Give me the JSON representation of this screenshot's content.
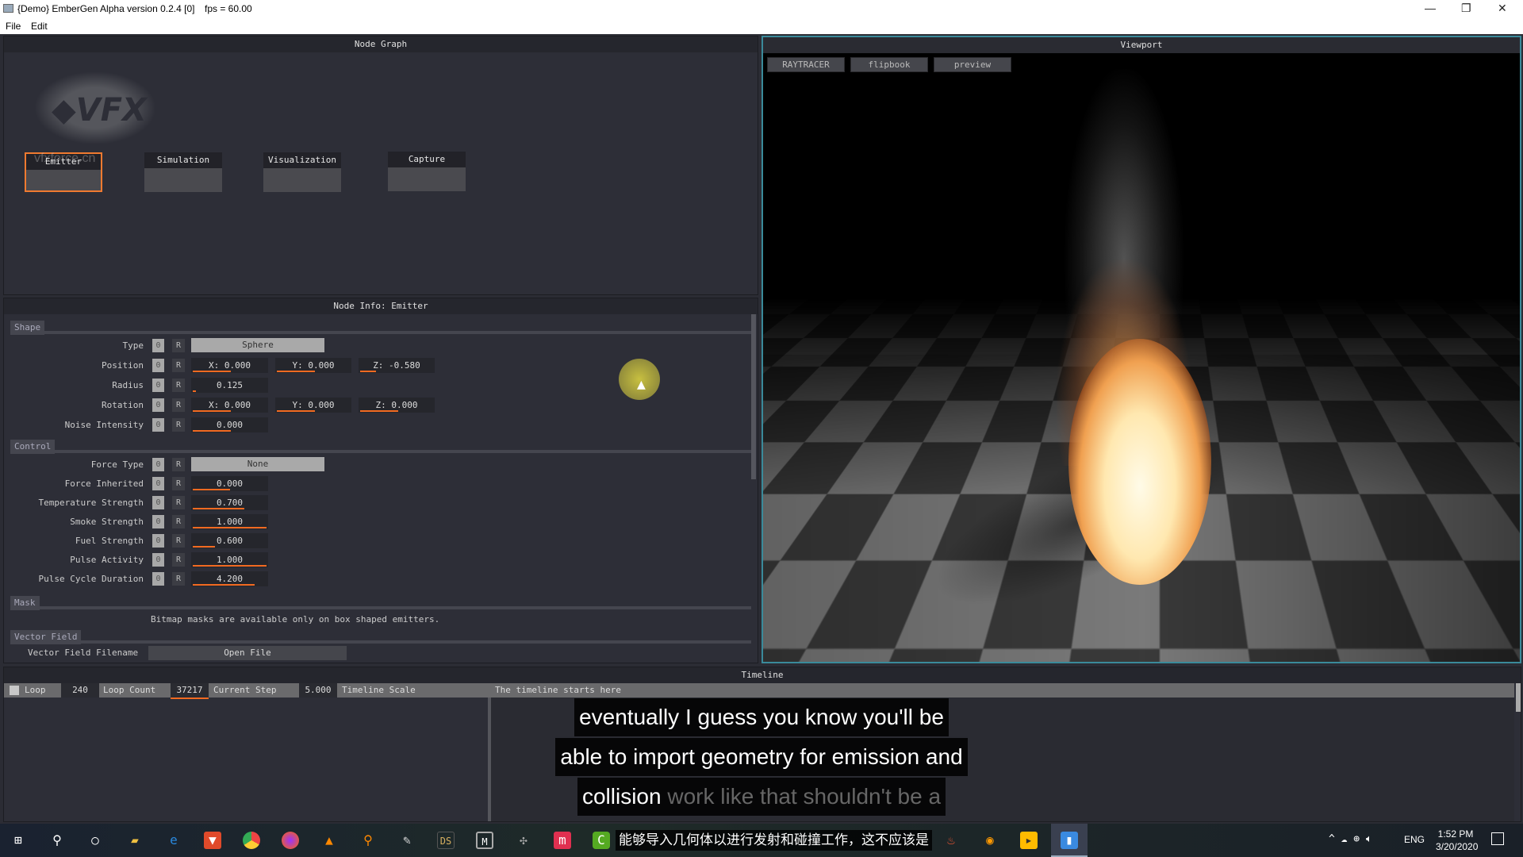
{
  "window": {
    "title": "{Demo} EmberGen Alpha version 0.2.4 [0]",
    "fps": "fps = 60.00",
    "minimize": "—",
    "restore": "❐",
    "close": "✕"
  },
  "menu": [
    "File",
    "Edit"
  ],
  "node_graph": {
    "title": "Node Graph",
    "logo_text": "VFX",
    "watermark": "vfxforce.cn",
    "nodes": [
      "Emitter",
      "Simulation",
      "Visualization",
      "Capture"
    ],
    "selected": "Emitter"
  },
  "node_info": {
    "title": "Node Info: Emitter",
    "sections": {
      "shape": "Shape",
      "control": "Control",
      "mask": "Mask",
      "vector_field": "Vector Field"
    },
    "btn_zero": "0",
    "btn_reset": "R",
    "shape": {
      "type": {
        "label": "Type",
        "value": "Sphere"
      },
      "position": {
        "label": "Position",
        "x": "X: 0.000",
        "y": "Y: 0.000",
        "z": "Z: -0.580"
      },
      "radius": {
        "label": "Radius",
        "value": "0.125"
      },
      "rotation": {
        "label": "Rotation",
        "x": "X: 0.000",
        "y": "Y: 0.000",
        "z": "Z: 0.000"
      },
      "noise": {
        "label": "Noise Intensity",
        "value": "0.000"
      }
    },
    "control": [
      {
        "label": "Force Type",
        "value": "None",
        "dropdown": true
      },
      {
        "label": "Force Inherited",
        "value": "0.000",
        "fill": 0.5
      },
      {
        "label": "Temperature Strength",
        "value": "0.700",
        "fill": 0.7
      },
      {
        "label": "Smoke Strength",
        "value": "1.000",
        "fill": 1.0
      },
      {
        "label": "Fuel Strength",
        "value": "0.600",
        "fill": 0.3
      },
      {
        "label": "Pulse Activity",
        "value": "1.000",
        "fill": 1.0
      },
      {
        "label": "Pulse Cycle Duration",
        "value": "4.200",
        "fill": 0.84
      }
    ],
    "mask_note": "Bitmap masks are available only on box shaped emitters.",
    "vector_field_label": "Vector Field Filename",
    "open_file": "Open File"
  },
  "viewport": {
    "title": "Viewport",
    "tabs": [
      "RAYTRACER",
      "flipbook",
      "preview"
    ]
  },
  "timeline": {
    "title": "Timeline",
    "loop": "Loop",
    "loop_count_value": "240",
    "loop_count": "Loop Count",
    "current_step_value": "37217",
    "current_step": "Current Step",
    "scale_value": "5.000",
    "scale": "Timeline Scale",
    "note": "The timeline starts here"
  },
  "subtitles": {
    "line1": "eventually I guess you know you'll be",
    "line2": "able to import geometry for emission and",
    "line3_a": "collision",
    "line3_b": "work like that shouldn't be a",
    "chinese": "能够导入几何体以进行发射和碰撞工作，这不应该是"
  },
  "taskbar": {
    "lang": "ENG",
    "time": "1:52 PM",
    "date": "3/20/2020"
  },
  "colors": {
    "accent": "#f26a21",
    "panel": "#2d2e37",
    "viewport_border": "#3a8a9a"
  }
}
